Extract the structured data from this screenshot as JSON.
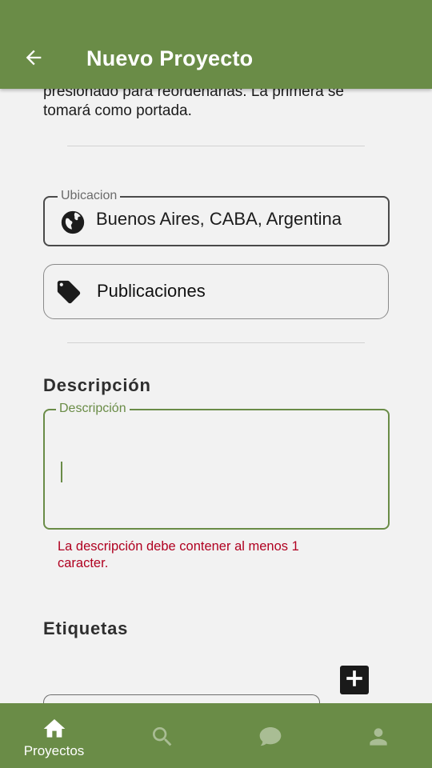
{
  "appbar": {
    "title": "Nuevo Proyecto",
    "back_icon": "arrow-back-icon"
  },
  "intro": {
    "text": "presionado para reordenarlas. La primera se tomará como portada."
  },
  "location": {
    "label": "Ubicacion",
    "value": "Buenos Aires, CABA, Argentina",
    "icon": "globe-icon"
  },
  "publications": {
    "label": "Publicaciones",
    "icon": "tag-icon"
  },
  "description": {
    "section_title": "Descripción",
    "field_label": "Descripción",
    "value": "",
    "error": "La descripción debe contener al menos 1 caracter."
  },
  "tags": {
    "section_title": "Etiquetas",
    "add_icon": "plus-icon"
  },
  "bottom_nav": {
    "items": [
      {
        "label": "Proyectos",
        "icon": "home-icon",
        "active": true
      },
      {
        "label": "",
        "icon": "search-icon",
        "active": false
      },
      {
        "label": "",
        "icon": "chat-icon",
        "active": false
      },
      {
        "label": "",
        "icon": "person-icon",
        "active": false
      }
    ]
  },
  "colors": {
    "primary": "#6a8c47",
    "error": "#b00020",
    "background": "#f2f2f2"
  }
}
